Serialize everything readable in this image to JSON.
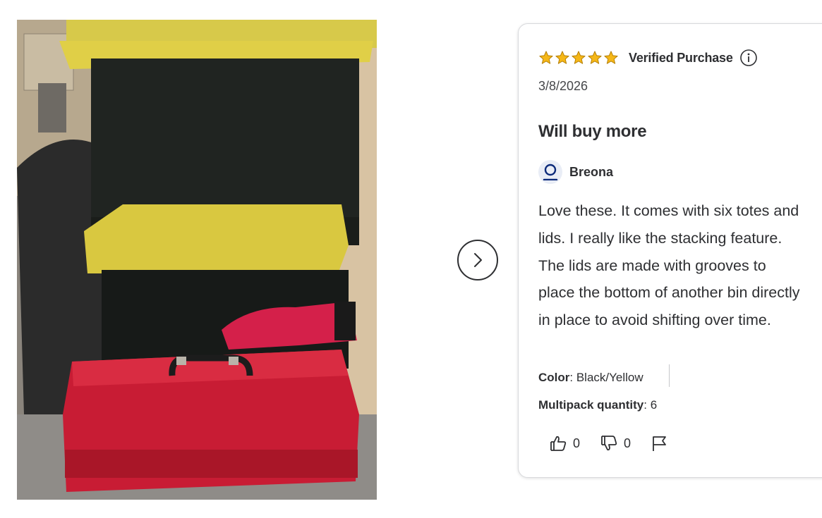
{
  "carousel": {
    "next_icon": "chevron-right-icon"
  },
  "review": {
    "rating": 5,
    "rating_max": 5,
    "star_color": "#f5b718",
    "verified_label": "Verified Purchase",
    "date": "3/8/2026",
    "title": "Will buy more",
    "author": "Breona",
    "avatar_color": "#0b2a7a",
    "body": "Love these. It comes with six totes and lids. I really like the stacking feature. The lids are made with grooves to place the bottom of another bin directly in place to avoid shifting over time.",
    "attributes": {
      "color_label": "Color",
      "color_value": "Black/Yellow",
      "qty_label": "Multipack quantity",
      "qty_value": "6"
    },
    "helpful_count": "0",
    "unhelpful_count": "0"
  },
  "icons": [
    "star-icon",
    "info-icon",
    "user-icon",
    "thumbs-up-icon",
    "thumbs-down-icon",
    "flag-icon",
    "chevron-right-icon"
  ]
}
